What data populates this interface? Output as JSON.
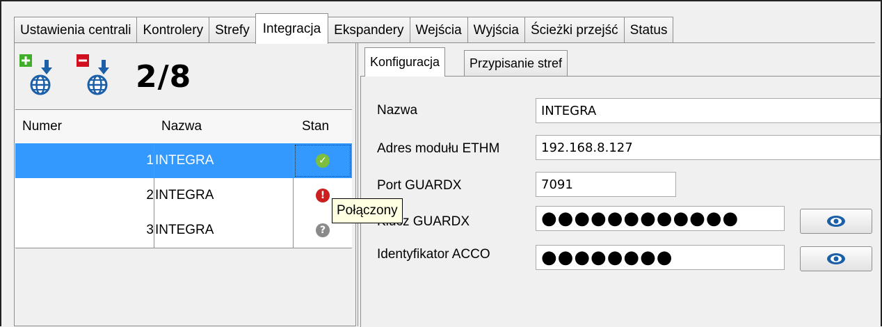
{
  "top_tabs": [
    "Ustawienia centrali",
    "Kontrolery",
    "Strefy",
    "Integracja",
    "Ekspandery",
    "Wejścia",
    "Wyjścia",
    "Ścieżki przejść",
    "Status"
  ],
  "active_top_tab": "Integracja",
  "toolbar": {
    "counter": "2/8"
  },
  "table": {
    "headers": {
      "numer": "Numer",
      "nazwa": "Nazwa",
      "stan": "Stan"
    },
    "rows": [
      {
        "numer": "1",
        "nazwa": "INTEGRA",
        "stan": "✓",
        "status": "ok"
      },
      {
        "numer": "2",
        "nazwa": "INTEGRA",
        "stan": "!",
        "status": "error"
      },
      {
        "numer": "3",
        "nazwa": "INTEGRA",
        "stan": "?",
        "status": "unknown"
      }
    ]
  },
  "tooltip": "Połączony",
  "inner_tabs": [
    "Konfiguracja",
    "Przypisanie stref"
  ],
  "form": {
    "nazwa_label": "Nazwa",
    "nazwa_value": "INTEGRA",
    "adres_label": "Adres modułu ETHM",
    "adres_value": "192.168.8.127",
    "port_label": "Port GUARDX",
    "port_value": "7091",
    "klucz_label": "Klucz GUARDX",
    "klucz_value": "●●●●●●●●●●●●",
    "acco_label": "Identyfikator ACCO",
    "acco_value": "●●●●●●●●"
  },
  "colors": {
    "selection": "#3399ff",
    "ok": "#7cbf3d",
    "error": "#cc1f1f",
    "unknown": "#8a8a8a",
    "tooltip_bg": "#ffffe1",
    "add": "#3fae29",
    "remove": "#d0101f"
  },
  "icons": [
    "add-integration-icon",
    "remove-integration-icon",
    "eye-icon"
  ]
}
